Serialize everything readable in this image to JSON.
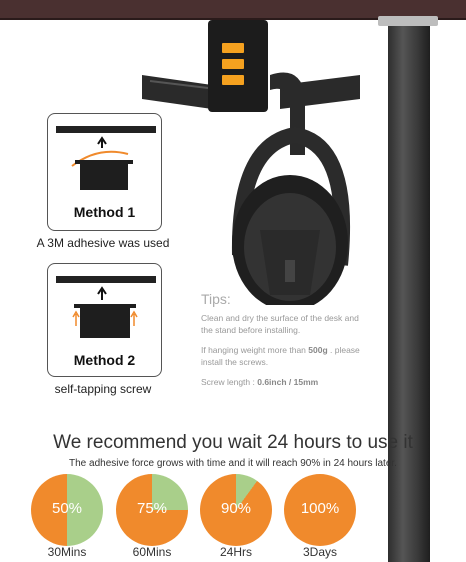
{
  "colors": {
    "orange": "#f08a2c",
    "green": "#a9cf8a",
    "pole": "#3a3a3a"
  },
  "method1": {
    "title": "Method 1",
    "caption": "A 3M adhesive was used"
  },
  "method2": {
    "title": "Method 2",
    "caption": "self-tapping screw"
  },
  "tips": {
    "title": "Tips:",
    "line1": "Clean and dry the surface of the desk and",
    "line2": "the stand before installing.",
    "line3_prefix": "If hanging weight more than ",
    "line3_bold": "500g",
    "line3_suffix": " . please",
    "line4": "install the screws.",
    "screw_prefix": "Screw length : ",
    "screw_value": "0.6inch / 15mm"
  },
  "headline": "We recommend you wait 24 hours to use it",
  "subline": "The adhesive force grows with time and it will reach 90% in 24 hours later.",
  "pies": [
    {
      "label": "50%",
      "caption": "30Mins",
      "percent": 50
    },
    {
      "label": "75%",
      "caption": "60Mins",
      "percent": 75
    },
    {
      "label": "90%",
      "caption": "24Hrs",
      "percent": 90
    },
    {
      "label": "100%",
      "caption": "3Days",
      "percent": 100
    }
  ]
}
